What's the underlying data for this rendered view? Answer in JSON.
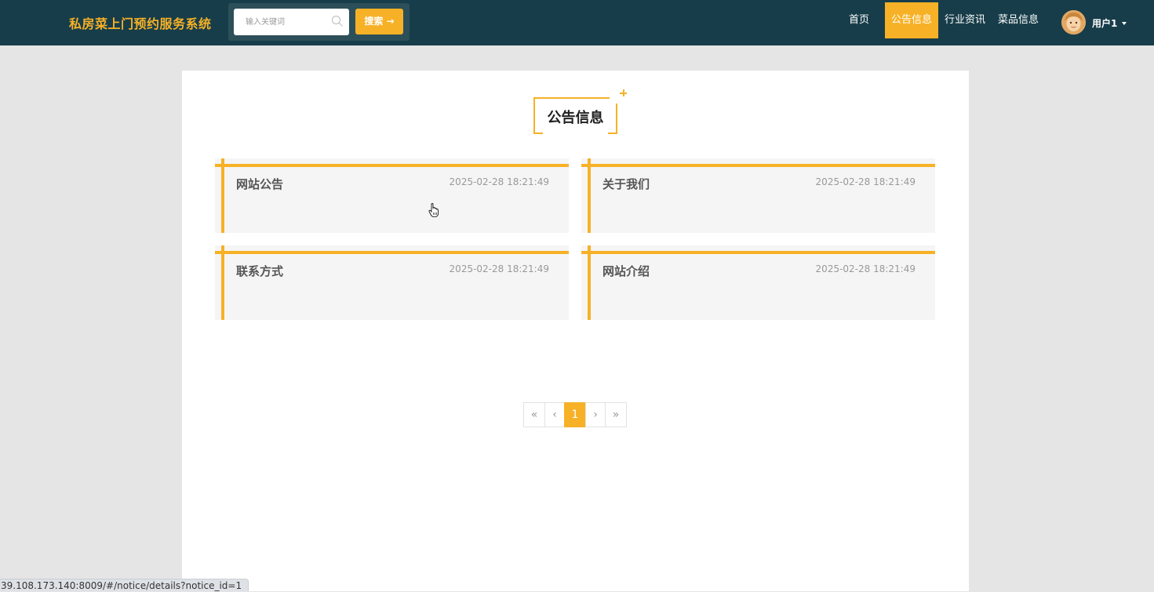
{
  "header": {
    "brand": "私房菜上门预约服务系统",
    "search": {
      "placeholder": "输入关键词",
      "button_label": "搜索 →"
    },
    "nav": [
      {
        "label": "首页",
        "active": false
      },
      {
        "label": "公告信息",
        "active": true
      },
      {
        "label": "行业资讯",
        "active": false
      },
      {
        "label": "菜品信息",
        "active": false
      }
    ],
    "user": {
      "name": "用户1"
    }
  },
  "main": {
    "section_title": "公告信息",
    "notices": [
      {
        "title": "网站公告",
        "time": "2025-02-28 18:21:49"
      },
      {
        "title": "关于我们",
        "time": "2025-02-28 18:21:49"
      },
      {
        "title": "联系方式",
        "time": "2025-02-28 18:21:49"
      },
      {
        "title": "网站介绍",
        "time": "2025-02-28 18:21:49"
      }
    ],
    "pagination": {
      "first": "«",
      "prev": "‹",
      "current": "1",
      "next": "›",
      "last": "»"
    }
  },
  "status_bar": {
    "url": "39.108.173.140:8009/#/notice/details?notice_id=1"
  },
  "colors": {
    "accent": "#f7b126",
    "header_bg": "#173d4a",
    "page_bg": "#e5e5e5"
  }
}
